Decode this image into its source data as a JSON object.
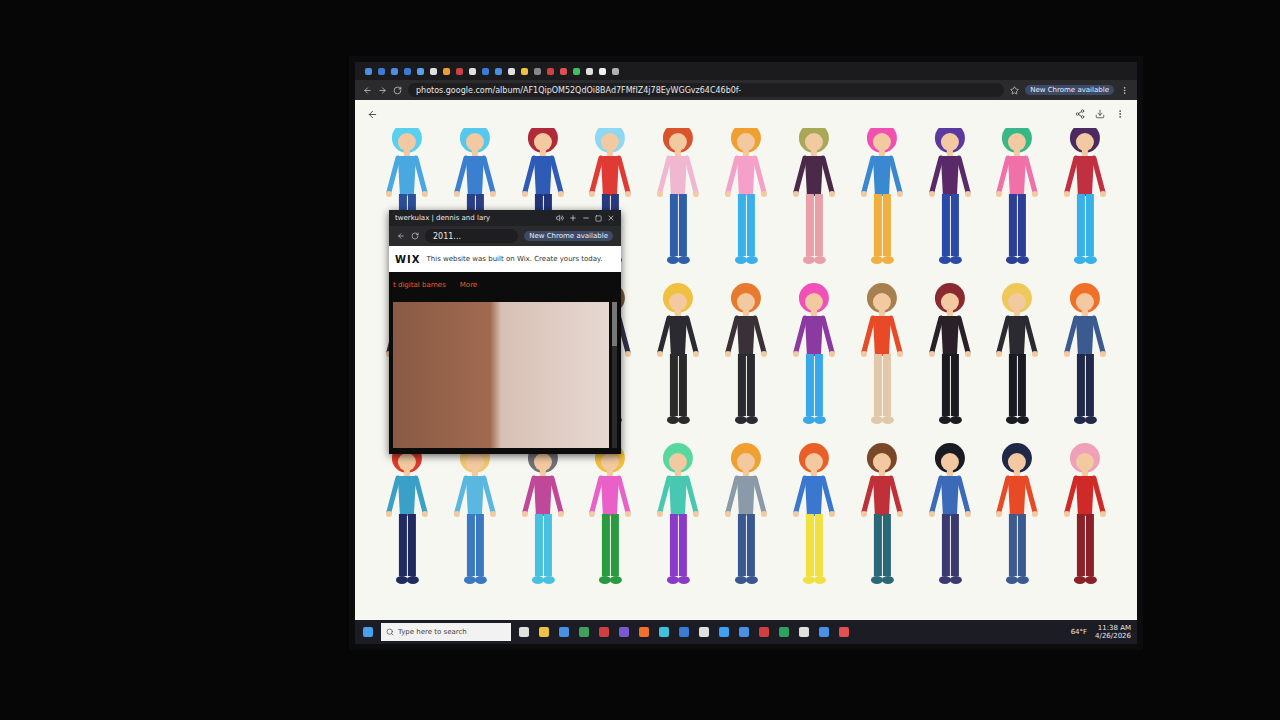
{
  "browser": {
    "url": "photos.google.com/album/AF1QipOM52QdOi8BAd7FMfIZ4j78EyWGGvz64C46b0f-",
    "update_badge": "New Chrome available"
  },
  "album": {
    "rows": [
      {
        "figures": [
          {
            "hair": "#5ad0f0",
            "top": "#4aa8e0",
            "legs": "#2c4f9a"
          },
          {
            "hair": "#56c8ee",
            "top": "#3b7fd0",
            "legs": "#2a3f85"
          },
          {
            "hair": "#b02a3a",
            "top": "#2e5bb5",
            "legs": "#23337a"
          },
          {
            "hair": "#8fd8f4",
            "top": "#e03a35",
            "legs": "#283a80"
          },
          {
            "hair": "#d9542a",
            "top": "#f0b8d0",
            "legs": "#2e5fa8"
          },
          {
            "hair": "#f0a030",
            "top": "#f4a0c8",
            "legs": "#3ab0e8"
          },
          {
            "hair": "#a8a858",
            "top": "#4a2a48",
            "legs": "#e8a0a8"
          },
          {
            "hair": "#f050b0",
            "top": "#3a88d0",
            "legs": "#f0b040"
          },
          {
            "hair": "#5a3aa0",
            "top": "#5a2a68",
            "legs": "#2a4aa8"
          },
          {
            "hair": "#38b888",
            "top": "#f070a8",
            "legs": "#2a3f95"
          },
          {
            "hair": "#4a2a60",
            "top": "#c03040",
            "legs": "#38b0e8"
          }
        ]
      },
      {
        "figures": [
          {
            "hair": "#e8b840",
            "top": "#3a3040",
            "legs": "#2a2a38"
          },
          {
            "hair": "#d06a30",
            "top": "#5a4838",
            "legs": "#4a4a50"
          },
          {
            "hair": "#c04060",
            "top": "#3a3a5a",
            "legs": "#2a3a70"
          },
          {
            "hair": "#7a5a38",
            "top": "#303048",
            "legs": "#3a3a48"
          },
          {
            "hair": "#f0c040",
            "top": "#2a2a30",
            "legs": "#2a2a2a"
          },
          {
            "hair": "#e87a30",
            "top": "#3a3038",
            "legs": "#2a2a30"
          },
          {
            "hair": "#f050b8",
            "top": "#8a3aa0",
            "legs": "#38a8e8"
          },
          {
            "hair": "#a88050",
            "top": "#e84a28",
            "legs": "#e0c8a8"
          },
          {
            "hair": "#8a2a30",
            "top": "#2a2028",
            "legs": "#1a1a20"
          },
          {
            "hair": "#f0c858",
            "top": "#2a2a30",
            "legs": "#1a1a22"
          },
          {
            "hair": "#f07028",
            "top": "#3a5a90",
            "legs": "#202a48"
          }
        ]
      },
      {
        "figures": [
          {
            "hair": "#e03a28",
            "top": "#3aa0c8",
            "legs": "#202a60"
          },
          {
            "hair": "#f0c870",
            "top": "#5ab8e0",
            "legs": "#3a78c0"
          },
          {
            "hair": "#707078",
            "top": "#c04898",
            "legs": "#48c0e0"
          },
          {
            "hair": "#f0c040",
            "top": "#e860c8",
            "legs": "#2a9a40"
          },
          {
            "hair": "#58d8a0",
            "top": "#48c8b0",
            "legs": "#8a3ac8"
          },
          {
            "hair": "#f0a030",
            "top": "#8a9aa8",
            "legs": "#3a5890"
          },
          {
            "hair": "#e86028",
            "top": "#3a78d0",
            "legs": "#f0e040"
          },
          {
            "hair": "#7a4828",
            "top": "#c03038",
            "legs": "#2a6878"
          },
          {
            "hair": "#1a1a22",
            "top": "#3a6ab8",
            "legs": "#3a3a70"
          },
          {
            "hair": "#202848",
            "top": "#e84a28",
            "legs": "#3a5a90"
          },
          {
            "hair": "#f0a0b8",
            "top": "#d02a28",
            "legs": "#8a2028"
          }
        ]
      }
    ]
  },
  "popup": {
    "title": "twerkulax | dennis and lary",
    "url": "2011...",
    "update_badge": "New Chrome available",
    "wix_brand": "WIX",
    "wix_message": "This website was built on Wix. Create yours today.",
    "nav": [
      "t digital barnes",
      "More"
    ]
  },
  "taskbar": {
    "search_placeholder": "Type here to search",
    "weather": "64°F",
    "time": "11:38 AM",
    "date": "4/26/2026"
  }
}
